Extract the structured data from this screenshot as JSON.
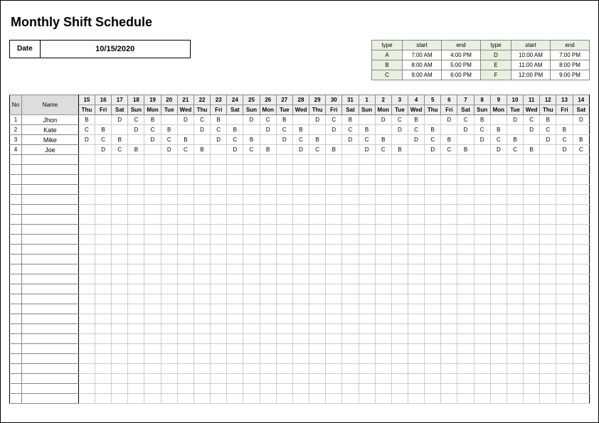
{
  "title": "Monthly Shift Schedule",
  "date_label": "Date",
  "date_value": "10/15/2020",
  "legend": {
    "headers": [
      "type",
      "start",
      "end",
      "type",
      "start",
      "end"
    ],
    "rows": [
      [
        "A",
        "7:00 AM",
        "4:00 PM",
        "D",
        "10:00 AM",
        "7:00 PM"
      ],
      [
        "B",
        "8:00 AM",
        "5:00 PM",
        "E",
        "11:00 AM",
        "8:00 PM"
      ],
      [
        "C",
        "9:00 AM",
        "6:00 PM",
        "F",
        "12:00 PM",
        "9:00 PM"
      ]
    ]
  },
  "schedule": {
    "no_label": "No",
    "name_label": "Name",
    "day_nums": [
      "15",
      "16",
      "17",
      "18",
      "19",
      "20",
      "21",
      "22",
      "23",
      "24",
      "25",
      "26",
      "27",
      "28",
      "29",
      "30",
      "31",
      "1",
      "2",
      "3",
      "4",
      "5",
      "6",
      "7",
      "8",
      "9",
      "10",
      "11",
      "12",
      "13",
      "14"
    ],
    "day_names": [
      "Thu",
      "Fri",
      "Sat",
      "Sun",
      "Mon",
      "Tue",
      "Wed",
      "Thu",
      "Fri",
      "Sat",
      "Sun",
      "Mon",
      "Tue",
      "Wed",
      "Thu",
      "Fri",
      "Sat",
      "Sun",
      "Mon",
      "Tue",
      "Wed",
      "Thu",
      "Fri",
      "Sat",
      "Sun",
      "Mon",
      "Tue",
      "Wed",
      "Thu",
      "Fri",
      "Sat"
    ],
    "rows": [
      {
        "no": "1",
        "name": "Jhon",
        "cells": [
          "B",
          "",
          "D",
          "C",
          "B",
          "",
          "D",
          "C",
          "B",
          "",
          "D",
          "C",
          "B",
          "",
          "D",
          "C",
          "B",
          "",
          "D",
          "C",
          "B",
          "",
          "D",
          "C",
          "B",
          "",
          "D",
          "C",
          "B",
          "",
          "D"
        ]
      },
      {
        "no": "2",
        "name": "Kate",
        "cells": [
          "C",
          "B",
          "",
          "D",
          "C",
          "B",
          "",
          "D",
          "C",
          "B",
          "",
          "D",
          "C",
          "B",
          "",
          "D",
          "C",
          "B",
          "",
          "D",
          "C",
          "B",
          "",
          "D",
          "C",
          "B",
          "",
          "D",
          "C",
          "B",
          ""
        ]
      },
      {
        "no": "3",
        "name": "Mike",
        "cells": [
          "D",
          "C",
          "B",
          "",
          "D",
          "C",
          "B",
          "",
          "D",
          "C",
          "B",
          "",
          "D",
          "C",
          "B",
          "",
          "D",
          "C",
          "B",
          "",
          "D",
          "C",
          "B",
          "",
          "D",
          "C",
          "B",
          "",
          "D",
          "C",
          "B"
        ]
      },
      {
        "no": "4",
        "name": "Joe",
        "cells": [
          "",
          "D",
          "C",
          "B",
          "",
          "D",
          "C",
          "B",
          "",
          "D",
          "C",
          "B",
          "",
          "D",
          "C",
          "B",
          "",
          "D",
          "C",
          "B",
          "",
          "D",
          "C",
          "B",
          "",
          "D",
          "C",
          "B",
          "",
          "D",
          "C"
        ]
      }
    ],
    "empty_rows": 25
  }
}
